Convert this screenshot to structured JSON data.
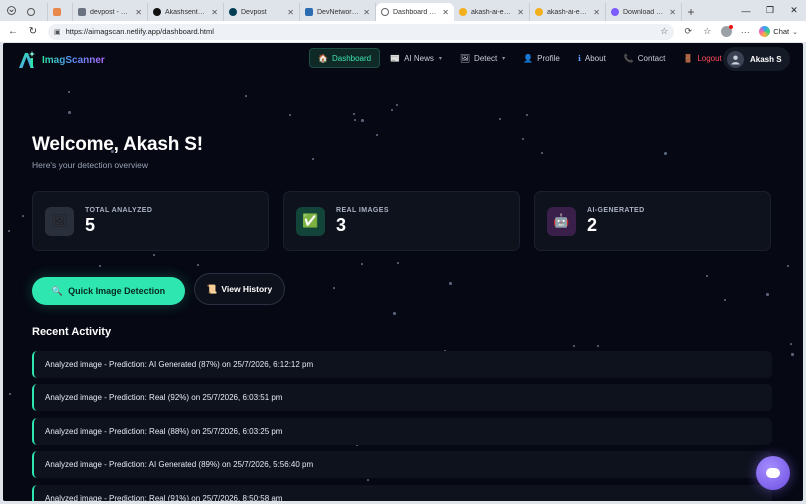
{
  "browser": {
    "tabs": [
      {
        "title": "",
        "favicon_color": "#e8884a",
        "has_close": false
      },
      {
        "title": "devpost - Search",
        "favicon_color": "#6b7280",
        "has_close": true
      },
      {
        "title": "Akashsenthilkum",
        "favicon_color": "#111111",
        "has_close": true
      },
      {
        "title": "Devpost",
        "favicon_color": "#003e54",
        "has_close": true
      },
      {
        "title": "DevNetwork Hac",
        "favicon_color": "#2b6cb0",
        "has_close": true
      },
      {
        "title": "Dashboard - AI S",
        "favicon_color": "#5f6368",
        "has_close": true,
        "active": true
      },
      {
        "title": "akash-ai-engine",
        "favicon_color": "#f2b01e",
        "has_close": true
      },
      {
        "title": "akash-ai-engine",
        "favicon_color": "#f2b01e",
        "has_close": true
      },
      {
        "title": "Download - Ima",
        "favicon_color": "#7b5cff",
        "has_close": true
      }
    ],
    "url": "https://aimagscan.netlify.app/dashboard.html",
    "chat_label": "Chat"
  },
  "nav": {
    "brand": "ImagScanner",
    "links": [
      {
        "label": "Dashboard",
        "icon": "🏠",
        "active": true
      },
      {
        "label": "AI News",
        "icon": "📰",
        "caret": true
      },
      {
        "label": "Detect",
        "icon": "🖼",
        "caret": true
      },
      {
        "label": "Profile",
        "icon": "👤"
      },
      {
        "label": "About",
        "icon": "ℹ"
      },
      {
        "label": "Contact",
        "icon": "📞"
      },
      {
        "label": "Logout",
        "icon": "🚪",
        "logout": true
      }
    ],
    "user": "Akash S"
  },
  "welcome": {
    "title": "Welcome, Akash S!",
    "subtitle": "Here's your detection overview"
  },
  "stats": [
    {
      "label": "TOTAL ANALYZED",
      "value": "5",
      "icon": "🖼",
      "icon_bg": "#2a2f3c"
    },
    {
      "label": "REAL IMAGES",
      "value": "3",
      "icon": "✅",
      "icon_bg": "#12443a"
    },
    {
      "label": "AI-GENERATED",
      "value": "2",
      "icon": "🤖",
      "icon_bg": "#3a1f4a"
    }
  ],
  "actions": {
    "primary": {
      "label": "Quick Image Detection",
      "icon": "🔍"
    },
    "secondary": {
      "label": "View History",
      "icon": "📜"
    }
  },
  "recent": {
    "title": "Recent Activity",
    "items": [
      "Analyzed image - Prediction: AI Generated (87%) on 25/7/2026, 6:12:12 pm",
      "Analyzed image - Prediction: Real (92%) on 25/7/2026, 6:03:51 pm",
      "Analyzed image - Prediction: Real (88%) on 25/7/2026, 6:03:25 pm",
      "Analyzed image - Prediction: AI Generated (89%) on 25/7/2026, 5:56:40 pm",
      "Analyzed image - Prediction: Real (91%) on 25/7/2026, 8:50:58 am"
    ]
  },
  "colors": {
    "accent": "#2ee6b0",
    "page_bg": "#060813",
    "card_bg": "#0e121d",
    "logout": "#ff4d5e"
  }
}
